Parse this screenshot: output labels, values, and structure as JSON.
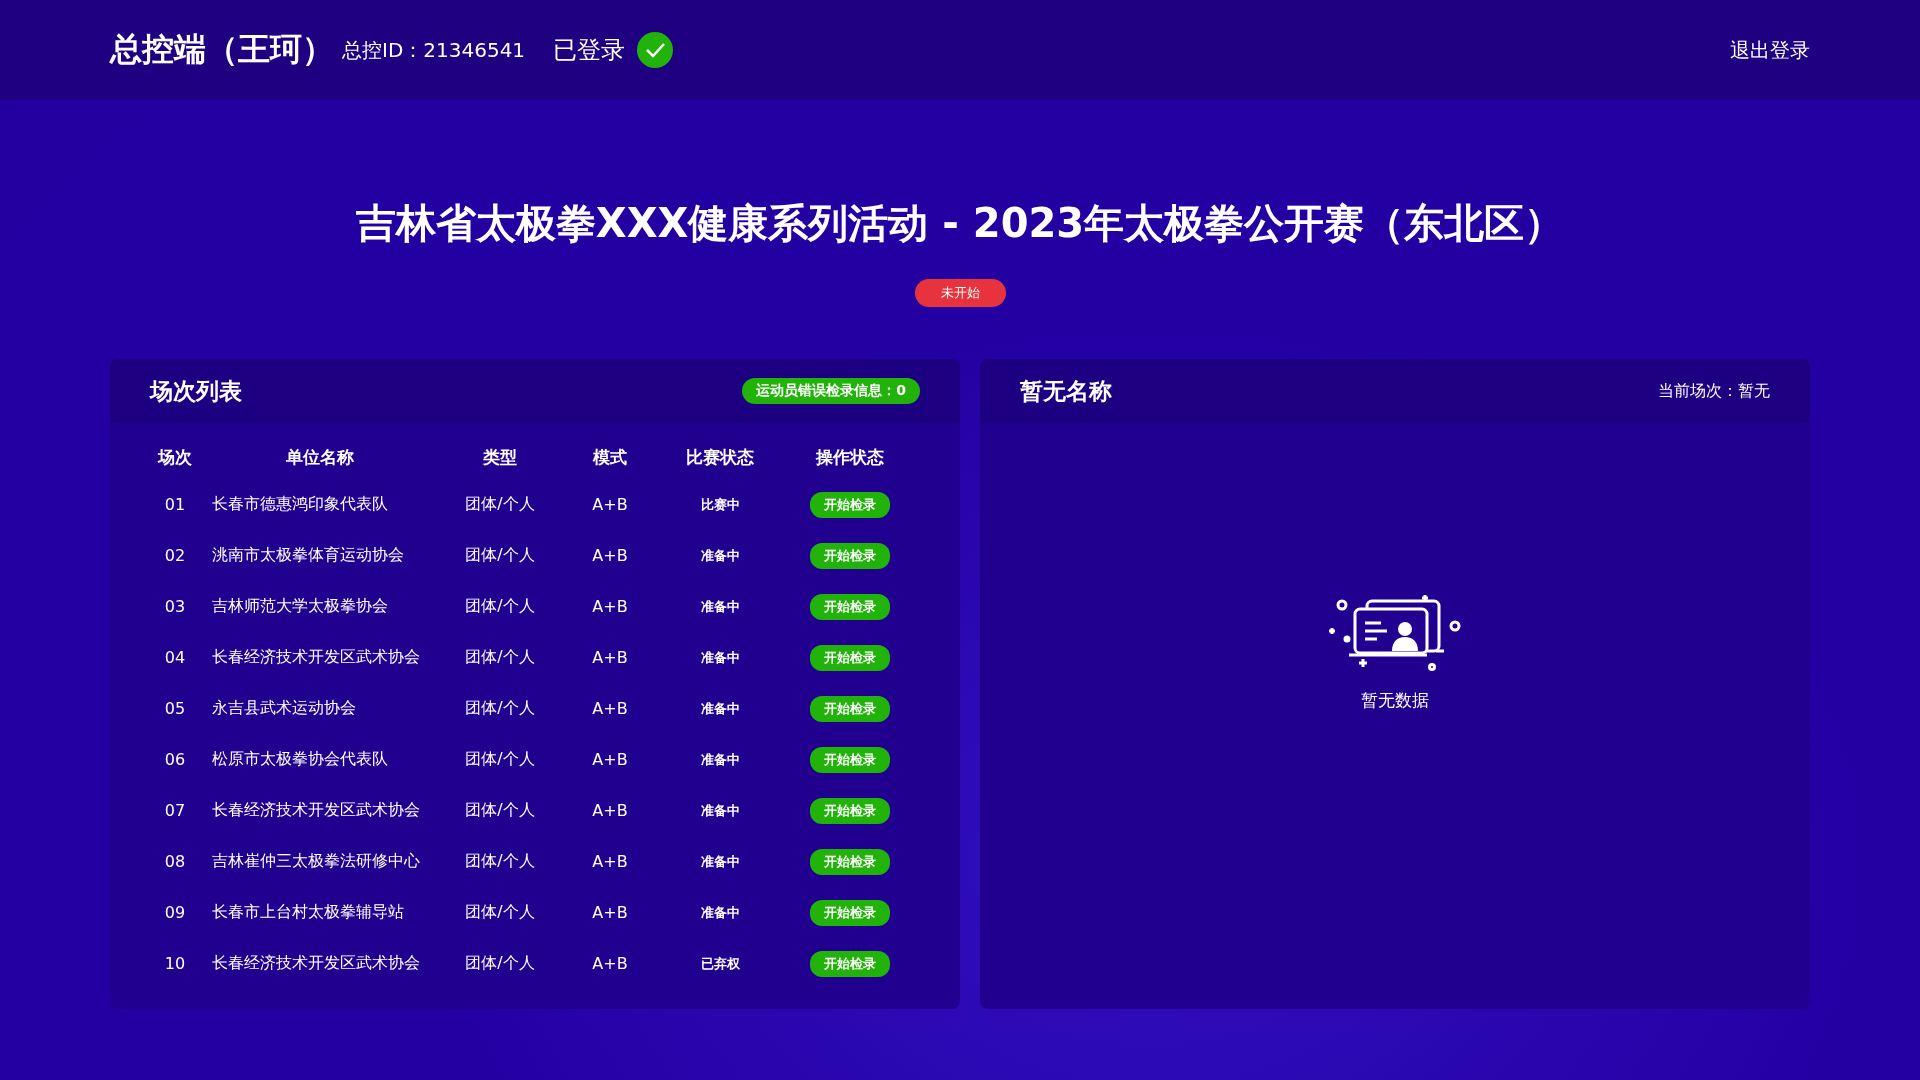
{
  "header": {
    "title": "总控端（王珂）",
    "id_label": "总控ID：21346541",
    "login_status": "已登录",
    "logout": "退出登录"
  },
  "event": {
    "title": "吉林省太极拳XXX健康系列活动 - 2023年太极拳公开赛（东北区）",
    "status": "未开始"
  },
  "session_panel": {
    "title": "场次列表",
    "error_badge": "运动员错误检录信息：0",
    "columns": [
      "场次",
      "单位名称",
      "类型",
      "模式",
      "比赛状态",
      "操作状态"
    ],
    "rows": [
      {
        "no": "01",
        "unit": "长春市德惠鸿印象代表队",
        "type": "团体/个人",
        "mode": "A+B",
        "match_status": "比赛中",
        "action": "开始检录"
      },
      {
        "no": "02",
        "unit": "洮南市太极拳体育运动协会",
        "type": "团体/个人",
        "mode": "A+B",
        "match_status": "准备中",
        "action": "开始检录"
      },
      {
        "no": "03",
        "unit": "吉林师范大学太极拳协会",
        "type": "团体/个人",
        "mode": "A+B",
        "match_status": "准备中",
        "action": "开始检录"
      },
      {
        "no": "04",
        "unit": "长春经济技术开发区武术协会",
        "type": "团体/个人",
        "mode": "A+B",
        "match_status": "准备中",
        "action": "开始检录"
      },
      {
        "no": "05",
        "unit": "永吉县武术运动协会",
        "type": "团体/个人",
        "mode": "A+B",
        "match_status": "准备中",
        "action": "开始检录"
      },
      {
        "no": "06",
        "unit": "松原市太极拳协会代表队",
        "type": "团体/个人",
        "mode": "A+B",
        "match_status": "准备中",
        "action": "开始检录"
      },
      {
        "no": "07",
        "unit": "长春经济技术开发区武术协会",
        "type": "团体/个人",
        "mode": "A+B",
        "match_status": "准备中",
        "action": "开始检录"
      },
      {
        "no": "08",
        "unit": "吉林崔仲三太极拳法研修中心",
        "type": "团体/个人",
        "mode": "A+B",
        "match_status": "准备中",
        "action": "开始检录"
      },
      {
        "no": "09",
        "unit": "长春市上台村太极拳辅导站",
        "type": "团体/个人",
        "mode": "A+B",
        "match_status": "准备中",
        "action": "开始检录"
      },
      {
        "no": "10",
        "unit": "长春经济技术开发区武术协会",
        "type": "团体/个人",
        "mode": "A+B",
        "match_status": "已弃权",
        "action": "开始检录"
      }
    ]
  },
  "detail_panel": {
    "title": "暂无名称",
    "current_session": "当前场次：暂无",
    "empty_text": "暂无数据"
  }
}
